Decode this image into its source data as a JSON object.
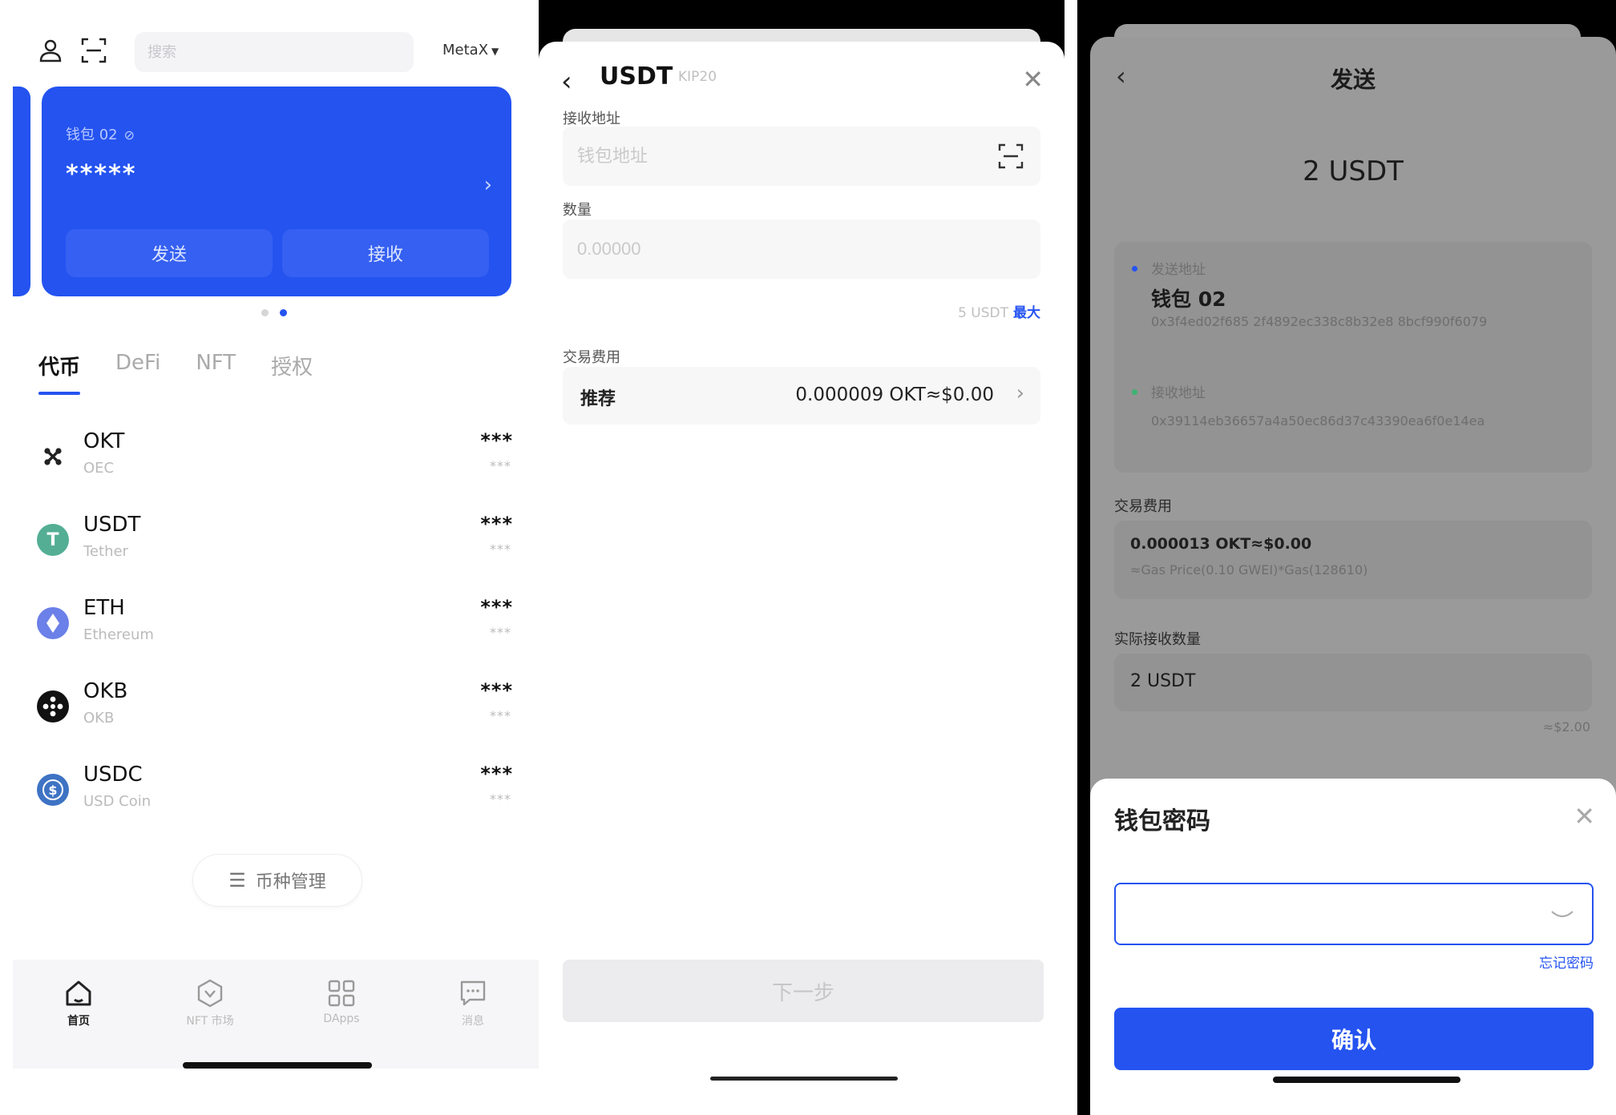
{
  "home": {
    "search_placeholder": "搜索",
    "network": "MetaX",
    "card": {
      "wallet_name": "钱包 02",
      "balance_masked": "*****",
      "send_label": "发送",
      "receive_label": "接收"
    },
    "tabs": [
      "代币",
      "DeFi",
      "NFT",
      "授权"
    ],
    "active_tab": 0,
    "tokens": [
      {
        "symbol": "OKT",
        "chain": "OEC",
        "balance": "***",
        "fiat": "***",
        "icon": "okt-icon",
        "color": "#ffffff"
      },
      {
        "symbol": "USDT",
        "chain": "Tether",
        "balance": "***",
        "fiat": "***",
        "icon": "tether-icon",
        "color": "#53ae94"
      },
      {
        "symbol": "ETH",
        "chain": "Ethereum",
        "balance": "***",
        "fiat": "***",
        "icon": "ethereum-icon",
        "color": "#6b80e8"
      },
      {
        "symbol": "OKB",
        "chain": "OKB",
        "balance": "***",
        "fiat": "***",
        "icon": "okb-icon",
        "color": "#111111"
      },
      {
        "symbol": "USDC",
        "chain": "USD Coin",
        "balance": "***",
        "fiat": "***",
        "icon": "usdc-icon",
        "color": "#3e73c4"
      }
    ],
    "manage_label": "币种管理",
    "nav": [
      {
        "label": "首页",
        "icon": "home-icon",
        "active": true
      },
      {
        "label": "NFT 市场",
        "icon": "nft-market-icon",
        "active": false
      },
      {
        "label": "DApps",
        "icon": "dapps-icon",
        "active": false
      },
      {
        "label": "消息",
        "icon": "message-icon",
        "active": false
      }
    ]
  },
  "send": {
    "token": "USDT",
    "standard": "KIP20",
    "address_label": "接收地址",
    "address_placeholder": "钱包地址",
    "amount_label": "数量",
    "amount_placeholder": "0.00000",
    "available": "5 USDT",
    "max_label": "最大",
    "fee_label": "交易费用",
    "fee_option": "推荐",
    "fee_value": "0.000009 OKT≈$0.00",
    "next_label": "下一步"
  },
  "confirm": {
    "title": "发送",
    "amount": "2 USDT",
    "from_label": "发送地址",
    "from_wallet": "钱包 02",
    "from_address": "0x3f4ed02f685 2f4892ec338c8b32e8 8bcf990f6079",
    "to_label": "接收地址",
    "to_address": "0x39114eb36657a4a50ec86d37c43390ea6f0e14ea",
    "fee_label": "交易费用",
    "fee_value": "0.000013 OKT≈$0.00",
    "fee_detail": "≈Gas Price(0.10 GWEI)*Gas(128610)",
    "receive_label": "实际接收数量",
    "receive_value": "2 USDT",
    "receive_fiat": "≈$2.00",
    "accent": "#2453f0"
  },
  "password": {
    "title": "钱包密码",
    "forgot_label": "忘记密码",
    "confirm_label": "确认"
  }
}
